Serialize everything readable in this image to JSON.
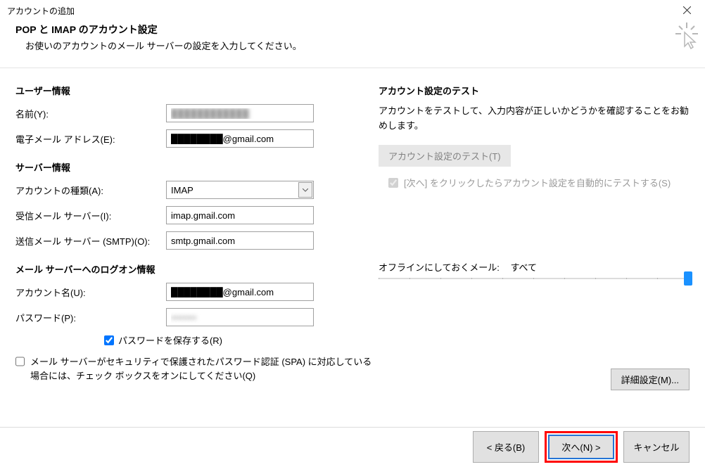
{
  "window": {
    "title": "アカウントの追加"
  },
  "header": {
    "title": "POP と IMAP のアカウント設定",
    "subtitle": "お使いのアカウントのメール サーバーの設定を入力してください。"
  },
  "user_info": {
    "section": "ユーザー情報",
    "name_label": "名前(Y):",
    "name_value": "████████████",
    "email_label": "電子メール アドレス(E):",
    "email_value": "████████@gmail.com"
  },
  "server_info": {
    "section": "サーバー情報",
    "account_type_label": "アカウントの種類(A):",
    "account_type_value": "IMAP",
    "incoming_label": "受信メール サーバー(I):",
    "incoming_value": "imap.gmail.com",
    "outgoing_label": "送信メール サーバー (SMTP)(O):",
    "outgoing_value": "smtp.gmail.com"
  },
  "logon_info": {
    "section": "メール サーバーへのログオン情報",
    "account_name_label": "アカウント名(U):",
    "account_name_value": "████████@gmail.com",
    "password_label": "パスワード(P):",
    "password_value": "●●●●●●●●",
    "save_password_label": "パスワードを保存する(R)"
  },
  "spa": {
    "text": "メール サーバーがセキュリティで保護されたパスワード認証 (SPA) に対応している場合には、チェック ボックスをオンにしてください(Q)"
  },
  "test": {
    "section": "アカウント設定のテスト",
    "desc": "アカウントをテストして、入力内容が正しいかどうかを確認することをお勧めします。",
    "btn": "アカウント設定のテスト(T)",
    "auto_test_label": "[次へ] をクリックしたらアカウント設定を自動的にテストする(S)"
  },
  "offline": {
    "label": "オフラインにしておくメール:",
    "value": "すべて"
  },
  "detail_btn": "詳細設定(M)...",
  "footer": {
    "back": "< 戻る(B)",
    "next": "次へ(N) >",
    "cancel": "キャンセル"
  }
}
